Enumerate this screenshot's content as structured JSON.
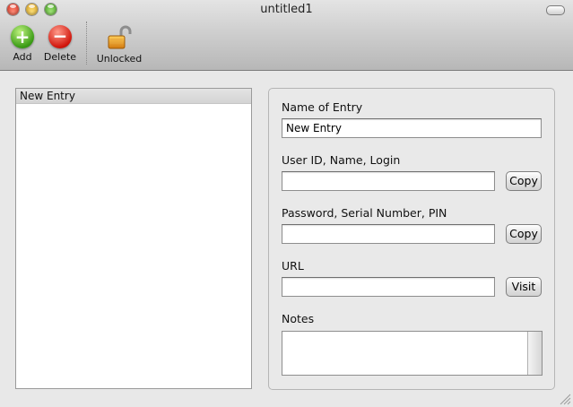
{
  "window": {
    "title": "untitled1"
  },
  "toolbar": {
    "add_label": "Add",
    "delete_label": "Delete",
    "lock_label": "Unlocked"
  },
  "entries": [
    {
      "label": "New Entry"
    }
  ],
  "form": {
    "name_label": "Name of Entry",
    "name_value": "New Entry",
    "userid_label": "User ID, Name, Login",
    "userid_value": "",
    "password_label": "Password, Serial Number, PIN",
    "password_value": "",
    "url_label": "URL",
    "url_value": "",
    "notes_label": "Notes",
    "notes_value": "",
    "copy_userid_label": "Copy",
    "copy_password_label": "Copy",
    "visit_label": "Visit"
  },
  "icons": {
    "close": "close-button-icon",
    "minimize": "minimize-button-icon",
    "zoom": "zoom-button-icon",
    "toolbar_toggle": "toolbar-toggle-icon",
    "add": "plus-icon",
    "delete": "minus-icon",
    "lock": "open-padlock-icon",
    "resize": "resize-grip-icon"
  }
}
